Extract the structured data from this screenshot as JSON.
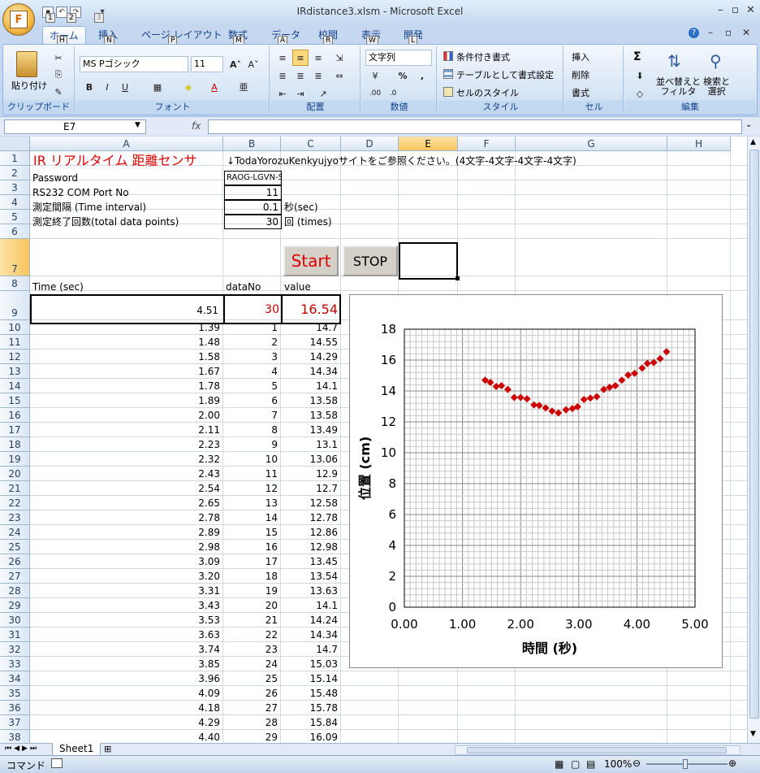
{
  "window": {
    "title": "IRdistance3.xlsm - Microsoft Excel",
    "office_button_letter": "F"
  },
  "qat": {
    "keytips": [
      "1",
      "2",
      "3"
    ]
  },
  "tabs": [
    {
      "label": "ホーム",
      "key": "H"
    },
    {
      "label": "挿入",
      "key": "N"
    },
    {
      "label": "ページ レイアウト",
      "key": "P"
    },
    {
      "label": "数式",
      "key": "M"
    },
    {
      "label": "データ",
      "key": "A"
    },
    {
      "label": "校閲",
      "key": "R"
    },
    {
      "label": "表示",
      "key": "W"
    },
    {
      "label": "開発",
      "key": "L"
    }
  ],
  "ribbon": {
    "clipboard": {
      "paste": "貼り付け",
      "label": "クリップボード"
    },
    "font": {
      "name": "MS Pゴシック",
      "size": "11",
      "label": "フォント",
      "bold": "B",
      "italic": "I",
      "underline": "U"
    },
    "alignment": {
      "label": "配置"
    },
    "number": {
      "format": "文字列",
      "label": "数値",
      "percent": "%",
      "comma": ","
    },
    "style": {
      "conditional": "条件付き書式",
      "table": "テーブルとして書式設定",
      "cellstyle": "セルのスタイル",
      "label": "スタイル"
    },
    "cells": {
      "insert": "挿入",
      "delete": "削除",
      "format": "書式",
      "label": "セル"
    },
    "editing": {
      "sum": "Σ",
      "sort": "並べ替えと\nフィルタ",
      "find": "検索と\n選択",
      "label": "編集"
    }
  },
  "formula_bar": {
    "name_box": "E7",
    "fx": "fx",
    "value": ""
  },
  "columns": [
    "A",
    "B",
    "C",
    "D",
    "E",
    "F",
    "G",
    "H"
  ],
  "selected_column": "E",
  "header_cells": {
    "title": "IR リアルタイム 距離センサ",
    "note": "↓TodaYorozuKenkyujyoサイトをご参照ください。(4文字-4文字-4文字-4文字)",
    "password_label": "Password",
    "password_value": "RAOG-LGVN-SCTW-LTZP",
    "com_label": "RS232 COM Port No",
    "com_value": "11",
    "interval_label": "測定間隔 (Time interval)",
    "interval_value": "0.1",
    "interval_unit": "秒(sec)",
    "count_label": "測定終了回数(total data points)",
    "count_value": "30",
    "count_unit": "回 (times)",
    "time_hdr": "Time (sec)",
    "no_hdr": "dataNo",
    "value_hdr": "value",
    "cur_time": "4.51",
    "cur_no": "30",
    "cur_value": "16.54"
  },
  "buttons": {
    "start": "Start",
    "stop": "STOP"
  },
  "row_numbers": [
    "1",
    "2",
    "3",
    "4",
    "5",
    "6",
    "7",
    "8",
    "9",
    "10",
    "11",
    "12",
    "13",
    "14",
    "15",
    "16",
    "17",
    "18",
    "19",
    "20",
    "21",
    "22",
    "23",
    "24",
    "25",
    "26",
    "27",
    "28",
    "29",
    "30",
    "31",
    "32",
    "33",
    "34",
    "35",
    "36",
    "37",
    "38"
  ],
  "data_rows": [
    [
      "1.39",
      "1",
      "14.7"
    ],
    [
      "1.48",
      "2",
      "14.55"
    ],
    [
      "1.58",
      "3",
      "14.29"
    ],
    [
      "1.67",
      "4",
      "14.34"
    ],
    [
      "1.78",
      "5",
      "14.1"
    ],
    [
      "1.89",
      "6",
      "13.58"
    ],
    [
      "2.00",
      "7",
      "13.58"
    ],
    [
      "2.11",
      "8",
      "13.49"
    ],
    [
      "2.23",
      "9",
      "13.1"
    ],
    [
      "2.32",
      "10",
      "13.06"
    ],
    [
      "2.43",
      "11",
      "12.9"
    ],
    [
      "2.54",
      "12",
      "12.7"
    ],
    [
      "2.65",
      "13",
      "12.58"
    ],
    [
      "2.78",
      "14",
      "12.78"
    ],
    [
      "2.89",
      "15",
      "12.86"
    ],
    [
      "2.98",
      "16",
      "12.98"
    ],
    [
      "3.09",
      "17",
      "13.45"
    ],
    [
      "3.20",
      "18",
      "13.54"
    ],
    [
      "3.31",
      "19",
      "13.63"
    ],
    [
      "3.43",
      "20",
      "14.1"
    ],
    [
      "3.53",
      "21",
      "14.24"
    ],
    [
      "3.63",
      "22",
      "14.34"
    ],
    [
      "3.74",
      "23",
      "14.7"
    ],
    [
      "3.85",
      "24",
      "15.03"
    ],
    [
      "3.96",
      "25",
      "15.14"
    ],
    [
      "4.09",
      "26",
      "15.48"
    ],
    [
      "4.18",
      "27",
      "15.78"
    ],
    [
      "4.29",
      "28",
      "15.84"
    ],
    [
      "4.40",
      "29",
      "16.09"
    ]
  ],
  "chart_data": {
    "type": "scatter",
    "xlabel": "時間 (秒)",
    "ylabel": "位置 (cm)",
    "xlim": [
      0,
      5
    ],
    "ylim": [
      0,
      18
    ],
    "xticks": [
      "0.00",
      "1.00",
      "2.00",
      "3.00",
      "4.00",
      "5.00"
    ],
    "yticks": [
      "0",
      "2",
      "4",
      "6",
      "8",
      "10",
      "12",
      "14",
      "16",
      "18"
    ],
    "grid": true,
    "marker_color": "#cc0000",
    "x": [
      1.39,
      1.48,
      1.58,
      1.67,
      1.78,
      1.89,
      2.0,
      2.11,
      2.23,
      2.32,
      2.43,
      2.54,
      2.65,
      2.78,
      2.89,
      2.98,
      3.09,
      3.2,
      3.31,
      3.43,
      3.53,
      3.63,
      3.74,
      3.85,
      3.96,
      4.09,
      4.18,
      4.29,
      4.4,
      4.51
    ],
    "y": [
      14.7,
      14.55,
      14.29,
      14.34,
      14.1,
      13.58,
      13.58,
      13.49,
      13.1,
      13.06,
      12.9,
      12.7,
      12.58,
      12.78,
      12.86,
      12.98,
      13.45,
      13.54,
      13.63,
      14.1,
      14.24,
      14.34,
      14.7,
      15.03,
      15.14,
      15.48,
      15.78,
      15.84,
      16.09,
      16.54
    ]
  },
  "sheet_tabs": {
    "active": "Sheet1"
  },
  "status": {
    "mode": "コマンド",
    "zoom": "100%"
  }
}
